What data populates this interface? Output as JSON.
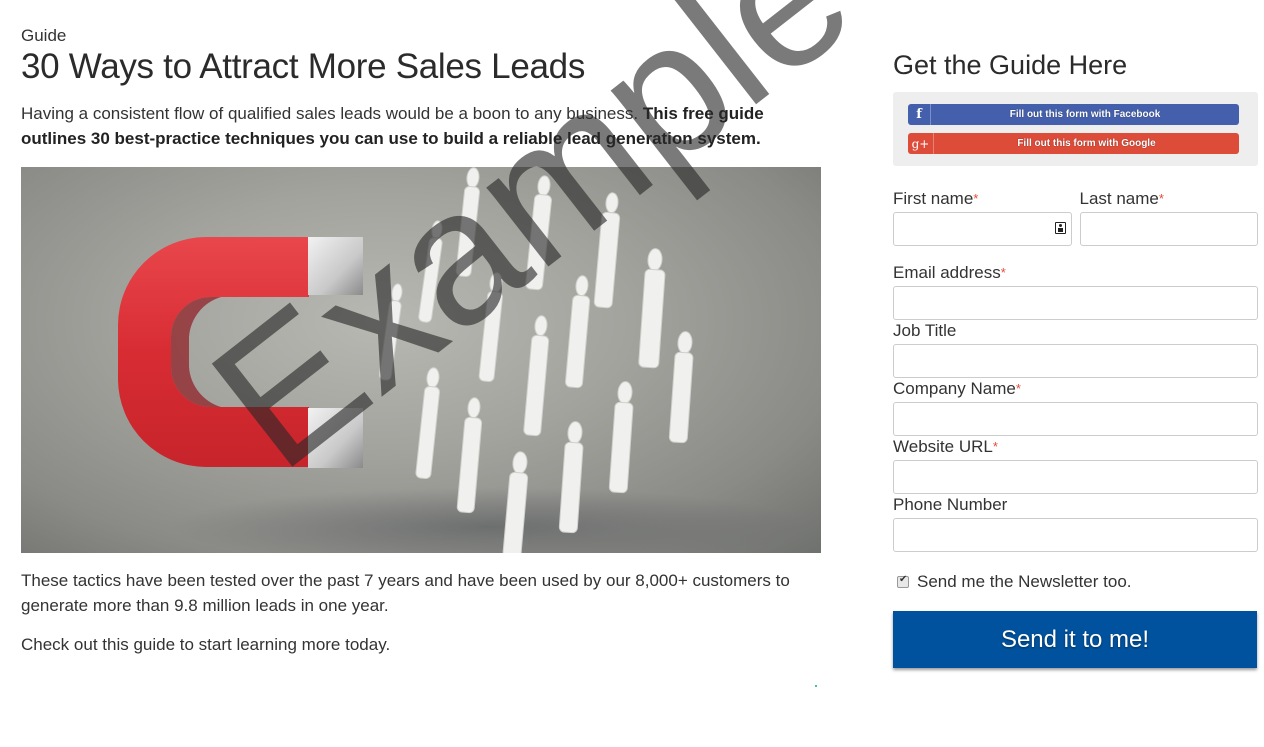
{
  "article": {
    "eyebrow": "Guide",
    "title": "30 Ways to Attract More Sales Leads",
    "intro_plain": "Having a consistent flow of qualified sales leads would be a boon to any business. ",
    "intro_bold": "This free guide outlines 30 best-practice techniques you can use to build a reliable lead generation system.",
    "hero_image_alt": "Red horseshoe magnet attracting white human figures",
    "paragraphs": [
      "These tactics have been tested over the past 7 years and have been used by our 8,000+ customers to generate more than 9.8 million leads in one year.",
      "Check out this guide to start learning more today."
    ]
  },
  "form": {
    "title": "Get the Guide Here",
    "social": {
      "facebook": {
        "icon": "f",
        "label": "Fill out this form with Facebook",
        "color": "#4460ad"
      },
      "google": {
        "icon": "g+",
        "label": "Fill out this form with Google",
        "color": "#dd4b39"
      }
    },
    "required_mark": "*",
    "fields": {
      "first_name": {
        "label": "First name",
        "required": true,
        "value": ""
      },
      "last_name": {
        "label": "Last name",
        "required": true,
        "value": ""
      },
      "email": {
        "label": "Email address",
        "required": true,
        "value": ""
      },
      "job_title": {
        "label": "Job Title",
        "required": false,
        "value": ""
      },
      "company": {
        "label": "Company Name",
        "required": true,
        "value": ""
      },
      "website": {
        "label": "Website URL",
        "required": true,
        "value": ""
      },
      "phone": {
        "label": "Phone Number",
        "required": false,
        "value": ""
      }
    },
    "newsletter": {
      "label": "Send me the Newsletter too.",
      "checked": true
    },
    "submit_label": "Send it to me!",
    "submit_color": "#01529e"
  },
  "watermark": "Example"
}
